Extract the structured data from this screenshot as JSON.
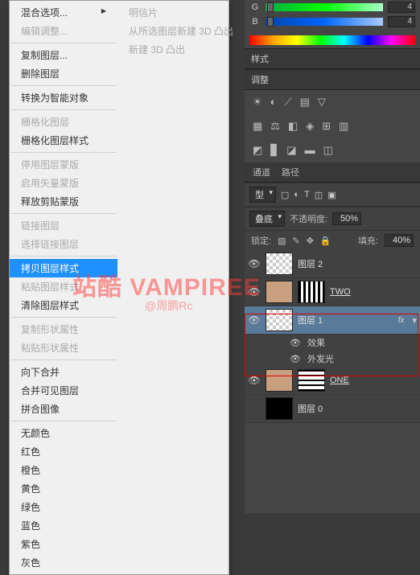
{
  "ctx": {
    "col1": [
      {
        "t": "混合选项...",
        "arrow": true
      },
      {
        "t": "编辑调整...",
        "disabled": true
      },
      {
        "sep": true
      },
      {
        "t": "复制图层..."
      },
      {
        "t": "删除图层"
      },
      {
        "sep": true
      },
      {
        "t": "转换为智能对象"
      },
      {
        "sep": true
      },
      {
        "t": "栅格化图层",
        "disabled": true
      },
      {
        "t": "栅格化图层样式"
      },
      {
        "sep": true
      },
      {
        "t": "停用图层蒙版",
        "disabled": true
      },
      {
        "t": "启用矢量蒙版",
        "disabled": true
      },
      {
        "t": "释放剪贴蒙版"
      },
      {
        "sep": true
      },
      {
        "t": "链接图层",
        "disabled": true
      },
      {
        "t": "选择链接图层",
        "disabled": true
      },
      {
        "sep": true
      },
      {
        "t": "拷贝图层样式",
        "sel": true
      },
      {
        "t": "粘贴图层样式",
        "disabled": true
      },
      {
        "t": "清除图层样式"
      },
      {
        "sep": true
      },
      {
        "t": "复制形状属性",
        "disabled": true
      },
      {
        "t": "粘贴形状属性",
        "disabled": true
      },
      {
        "sep": true
      },
      {
        "t": "向下合并"
      },
      {
        "t": "合并可见图层"
      },
      {
        "t": "拼合图像"
      },
      {
        "sep": true
      },
      {
        "t": "无颜色"
      },
      {
        "t": "红色"
      },
      {
        "t": "橙色"
      },
      {
        "t": "黄色"
      },
      {
        "t": "绿色"
      },
      {
        "t": "蓝色"
      },
      {
        "t": "紫色"
      },
      {
        "t": "灰色"
      }
    ],
    "col2": [
      {
        "t": "明信片",
        "disabled": true
      },
      {
        "t": "从所选图层新建 3D 凸出",
        "disabled": true
      },
      {
        "t": "新建 3D 凸出",
        "disabled": true
      }
    ]
  },
  "sliders": {
    "g": {
      "label": "G",
      "val": "4"
    },
    "b": {
      "label": "B",
      "val": "4"
    }
  },
  "panels": {
    "styleTab": "样式",
    "adjustTab": "调整",
    "channelsTab": "通道",
    "pathsTab": "路径"
  },
  "blend": {
    "mode": "叠底",
    "opacityLabel": "不透明度:",
    "opacity": "50%",
    "fillLabel": "填充:",
    "fill": "40%",
    "typeDd": "型"
  },
  "lock": {
    "label": "锁定:"
  },
  "layers": [
    {
      "name": "图层 2",
      "eye": true,
      "thumb": "check"
    },
    {
      "name": "TWO",
      "eye": true,
      "thumb": "stripes",
      "face": true,
      "u": true
    },
    {
      "name": "图层 1",
      "eye": true,
      "thumb": "check",
      "sel": true,
      "fx": "fx"
    },
    {
      "name": "ONE",
      "eye": true,
      "thumb": "lines",
      "face": true,
      "u": true
    },
    {
      "name": "图层 0",
      "eye": false,
      "thumb": "black"
    }
  ],
  "fx": {
    "effects": "效果",
    "outerGlow": "外发光"
  },
  "watermark": {
    "main": "站酷 VAMPIREE",
    "sub": "@周鹏Rc"
  }
}
